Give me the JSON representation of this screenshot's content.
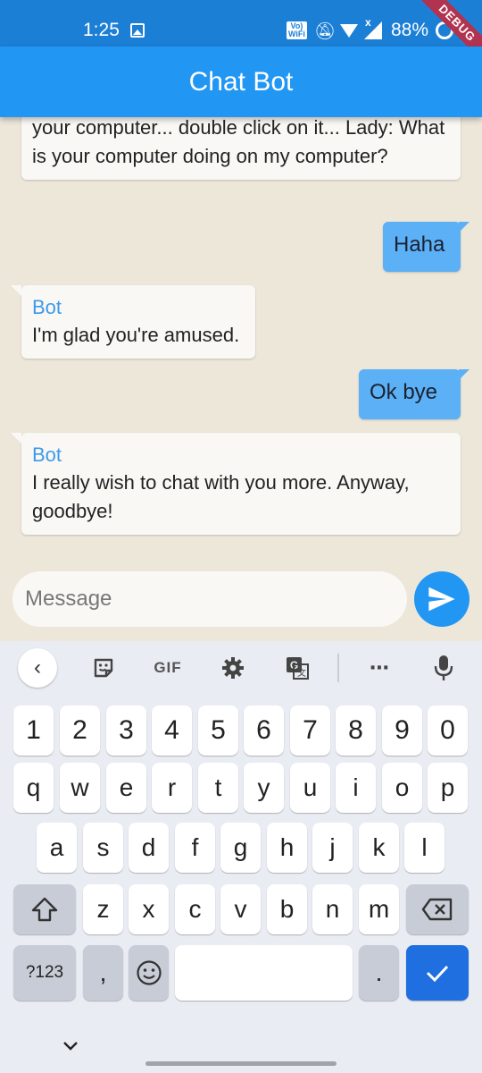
{
  "status_bar": {
    "time": "1:25",
    "network_label": "Vo) WiFi",
    "battery": "88%",
    "debug_label": "DEBUG"
  },
  "app_bar": {
    "title": "Chat Bot"
  },
  "messages": [
    {
      "sender": "bot",
      "name": "",
      "text": "your computer... double click on it... Lady: What is your computer doing on my computer?"
    },
    {
      "sender": "user",
      "text": "Haha"
    },
    {
      "sender": "bot",
      "name": "Bot",
      "text": "I'm glad you're amused."
    },
    {
      "sender": "user",
      "text": "Ok bye"
    },
    {
      "sender": "bot",
      "name": "Bot",
      "text": "I really wish to chat with you more. Anyway, goodbye!"
    }
  ],
  "composer": {
    "placeholder": "Message"
  },
  "keyboard": {
    "toolbar": {
      "gif_label": "GIF"
    },
    "rows": {
      "numbers": [
        "1",
        "2",
        "3",
        "4",
        "5",
        "6",
        "7",
        "8",
        "9",
        "0"
      ],
      "row1": [
        "q",
        "w",
        "e",
        "r",
        "t",
        "y",
        "u",
        "i",
        "o",
        "p"
      ],
      "row2": [
        "a",
        "s",
        "d",
        "f",
        "g",
        "h",
        "j",
        "k",
        "l"
      ],
      "row3": [
        "z",
        "x",
        "c",
        "v",
        "b",
        "n",
        "m"
      ]
    },
    "symbols_label": "?123",
    "comma_label": ",",
    "period_label": "."
  },
  "colors": {
    "app_bar": "#2196f3",
    "status_bar": "#1c7fd6",
    "chat_background": "#ede7da",
    "user_bubble": "#5cb0f6",
    "bot_bubble": "#faf8f5",
    "bot_name": "#3d9ae8",
    "enter_key": "#1f6fe0"
  }
}
